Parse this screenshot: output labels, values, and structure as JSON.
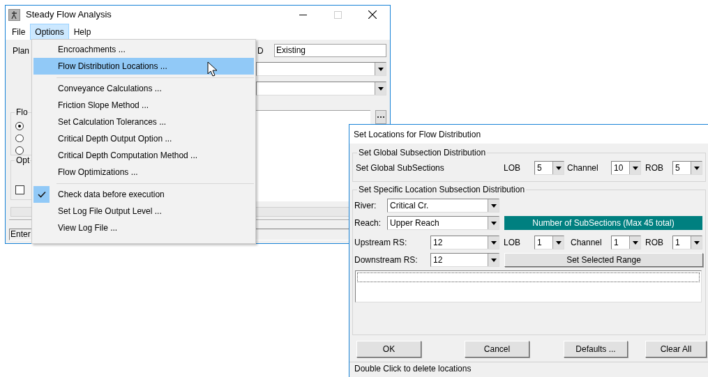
{
  "main_window": {
    "title": "Steady Flow Analysis",
    "menu": [
      {
        "label": "File",
        "selected": false
      },
      {
        "label": "Options",
        "selected": true
      },
      {
        "label": "Help",
        "selected": false
      }
    ],
    "plan_label": "Plan",
    "column_2_label": "D",
    "plan_field": "Existing",
    "flow_group": {
      "title": "Flo",
      "radios": [
        {
          "selected": true
        },
        {
          "selected": false
        },
        {
          "selected": false
        }
      ]
    },
    "options_group": {
      "title": "Opt",
      "checkbox": {
        "checked": false
      }
    },
    "status": "Enter"
  },
  "options_menu": {
    "groups": [
      [
        {
          "label": "Encroachments ...",
          "selected": false,
          "checked": false
        },
        {
          "label": "Flow Distribution Locations ...",
          "selected": true,
          "checked": false
        }
      ],
      [
        {
          "label": "Conveyance Calculations ...",
          "selected": false,
          "checked": false
        },
        {
          "label": "Friction Slope Method ...",
          "selected": false,
          "checked": false
        },
        {
          "label": "Set Calculation Tolerances ...",
          "selected": false,
          "checked": false
        },
        {
          "label": "Critical Depth Output Option ...",
          "selected": false,
          "checked": false
        },
        {
          "label": "Critical Depth Computation Method ...",
          "selected": false,
          "checked": false
        },
        {
          "label": "Flow Optimizations ...",
          "selected": false,
          "checked": false
        }
      ],
      [
        {
          "label": "Check data before execution",
          "selected": false,
          "checked": true
        },
        {
          "label": "Set Log File Output Level ...",
          "selected": false,
          "checked": false
        },
        {
          "label": "View Log File ...",
          "selected": false,
          "checked": false
        }
      ]
    ]
  },
  "dialog": {
    "title": "Set Locations for Flow Distribution",
    "global_group": {
      "title": "Set Global Subsection Distribution",
      "label": "Set Global SubSections",
      "combos": [
        {
          "label": "LOB",
          "value": "5"
        },
        {
          "label": "Channel",
          "value": "10"
        },
        {
          "label": "ROB",
          "value": "5"
        }
      ]
    },
    "specific_group": {
      "title": "Set Specific Location Subsection Distribution",
      "river": {
        "label": "River:",
        "value": "Critical Cr."
      },
      "reach": {
        "label": "Reach:",
        "value": "Upper Reach"
      },
      "banner": "Number of SubSections (Max 45 total)",
      "upstream": {
        "label": "Upstream RS:",
        "value": "12"
      },
      "combos": [
        {
          "label": "LOB",
          "value": "1"
        },
        {
          "label": "Channel",
          "value": "1"
        },
        {
          "label": "ROB",
          "value": "1"
        }
      ],
      "downstream": {
        "label": "Downstream RS:",
        "value": "12"
      },
      "range_button": "Set Selected Range"
    },
    "buttons": [
      "OK",
      "Cancel",
      "Defaults ...",
      "Clear All"
    ],
    "status": "Double Click to delete locations"
  }
}
